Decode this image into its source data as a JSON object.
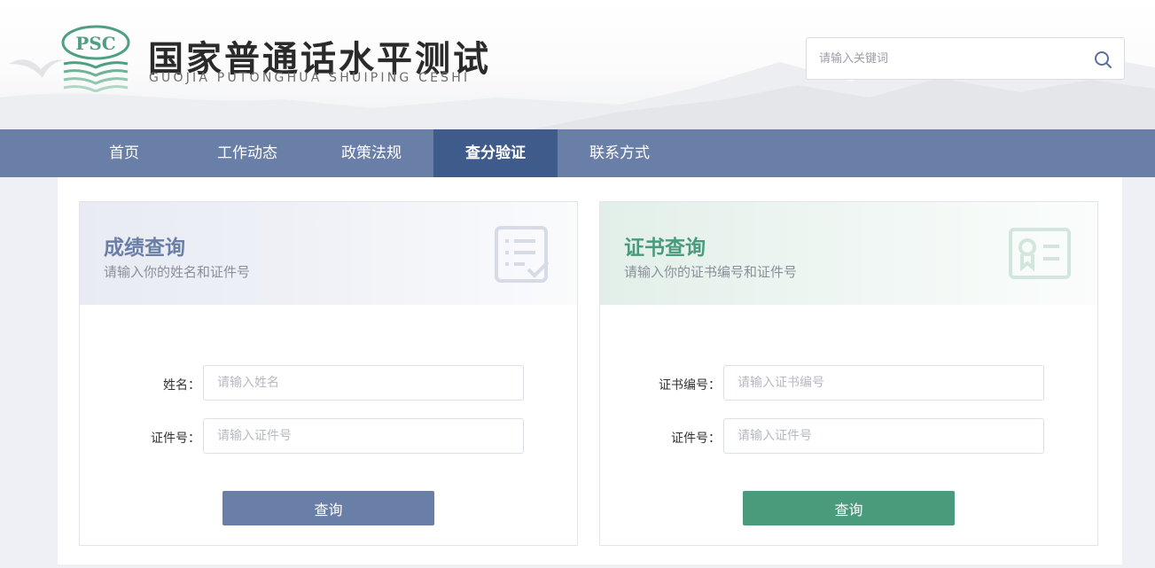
{
  "header": {
    "logo_text": "PSC",
    "title": "国家普通话水平测试",
    "subtitle": "GUOJIA PUTONGHUA SHUIPING CESHI",
    "search_placeholder": "请输入关键词",
    "search_icon": "search-icon"
  },
  "nav": {
    "items": [
      {
        "label": "首页",
        "active": false
      },
      {
        "label": "工作动态",
        "active": false
      },
      {
        "label": "政策法规",
        "active": false
      },
      {
        "label": "查分验证",
        "active": true
      },
      {
        "label": "联系方式",
        "active": false
      }
    ]
  },
  "score_card": {
    "title": "成绩查询",
    "description": "请输入你的姓名和证件号",
    "icon": "checklist-icon",
    "fields": [
      {
        "label": "姓名：",
        "placeholder": "请输入姓名"
      },
      {
        "label": "证件号：",
        "placeholder": "请输入证件号"
      }
    ],
    "submit_label": "查询"
  },
  "cert_card": {
    "title": "证书查询",
    "description": "请输入你的证书编号和证件号",
    "icon": "certificate-icon",
    "fields": [
      {
        "label": "证书编号：",
        "placeholder": "请输入证书编号"
      },
      {
        "label": "证件号：",
        "placeholder": "请输入证件号"
      }
    ],
    "submit_label": "查询"
  },
  "colors": {
    "nav_bg": "#6a7fa8",
    "nav_active": "#3f5b8c",
    "score_accent": "#6a7fa8",
    "cert_accent": "#4a9a7c",
    "logo_green": "#4f9f80"
  }
}
